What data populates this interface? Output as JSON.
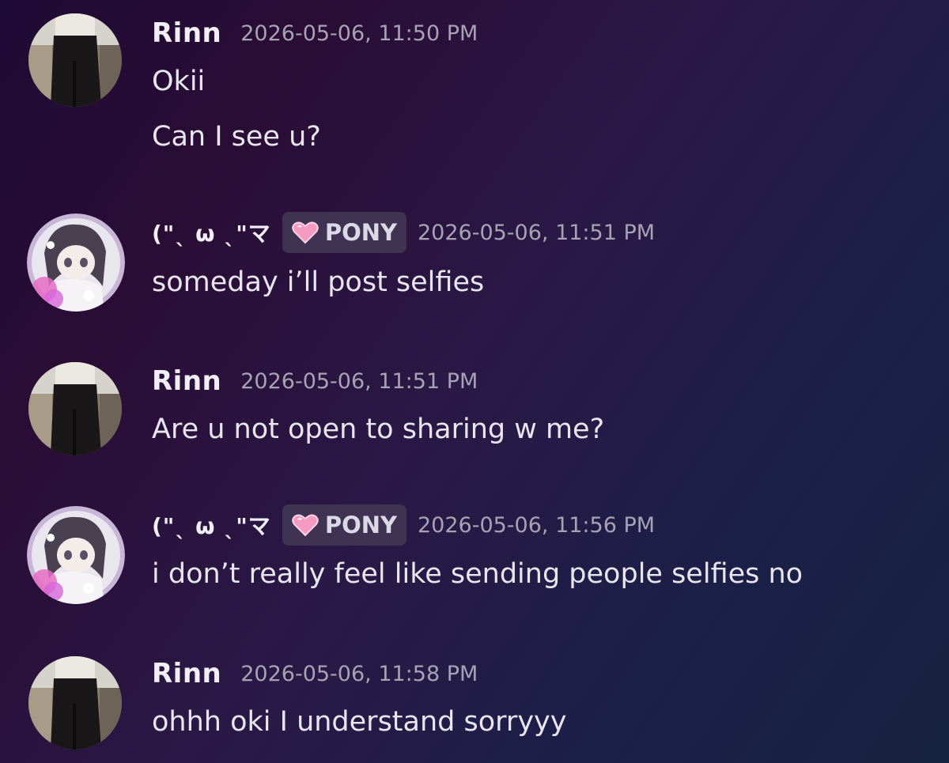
{
  "messages": [
    {
      "author": "Rinn",
      "timestamp": "2026-05-06, 11:50 PM",
      "lines": [
        "Okii",
        "Can I see u?"
      ]
    },
    {
      "author": "(\"ˎ ω ˎ\"マ",
      "tag": "PONY",
      "timestamp": "2026-05-06, 11:51 PM",
      "lines": [
        "someday i’ll post selfies"
      ]
    },
    {
      "author": "Rinn",
      "timestamp": "2026-05-06, 11:51 PM",
      "lines": [
        "Are u not open to sharing w me?"
      ]
    },
    {
      "author": "(\"ˎ ω ˎ\"マ",
      "tag": "PONY",
      "timestamp": "2026-05-06, 11:56 PM",
      "lines": [
        "i don’t really feel like sending people selfies no"
      ]
    },
    {
      "author": "Rinn",
      "timestamp": "2026-05-06, 11:58 PM",
      "lines": [
        "ohhh oki I understand sorryyy"
      ]
    }
  ],
  "colors": {
    "username": "#f1eef5",
    "timestamp": "#a8a3b4",
    "tag_background": "#3f3253",
    "tag_heart": "#f59ac0"
  },
  "icons": {
    "tag_icon": "pink-heart-icon"
  }
}
